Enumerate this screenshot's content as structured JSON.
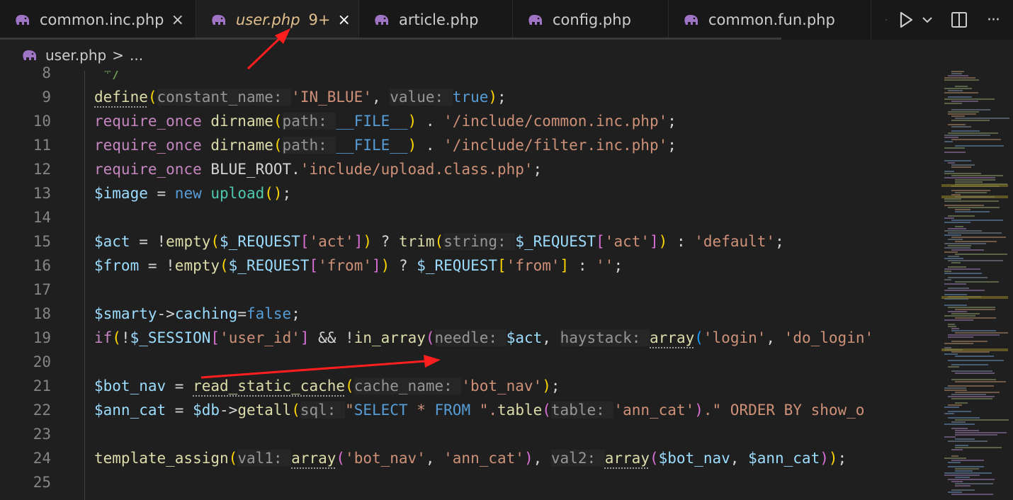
{
  "tabs": [
    {
      "label": "common.inc.php",
      "icon": "php-elephant-icon",
      "active": false,
      "close": "×"
    },
    {
      "label": "user.php",
      "icon": "php-elephant-icon",
      "active": true,
      "badge": "9+",
      "close": "×"
    },
    {
      "label": "article.php",
      "icon": "php-elephant-icon",
      "active": false
    },
    {
      "label": "config.php",
      "icon": "php-elephant-icon",
      "active": false
    },
    {
      "label": "common.fun.php",
      "icon": "php-elephant-icon",
      "active": false
    }
  ],
  "actions": {
    "run_icon": "play-icon",
    "run_dropdown_icon": "chevron-down-icon",
    "split_icon": "split-editor-icon",
    "more_icon": "more-actions-icon",
    "more_label": "···"
  },
  "breadcrumb": {
    "file": "user.php",
    "separator": ">",
    "more": "..."
  },
  "editor": {
    "line_numbers": [
      "8",
      "9",
      "10",
      "11",
      "12",
      "13",
      "14",
      "15",
      "16",
      "17",
      "18",
      "19",
      "20",
      "21",
      "22",
      "23",
      "24",
      "25"
    ]
  },
  "code_lines": [
    {
      "n": "8",
      "tokens": [
        {
          "t": " */",
          "c": "cm"
        }
      ]
    },
    {
      "n": "9",
      "tokens": [
        {
          "t": "define",
          "c": "f dl"
        },
        {
          "t": "(",
          "c": "y"
        },
        {
          "t": "constant_name: ",
          "c": "h"
        },
        {
          "t": "'IN_BLUE'",
          "c": "s"
        },
        {
          "t": ", "
        },
        {
          "t": "value: ",
          "c": "h"
        },
        {
          "t": "true",
          "c": "k"
        },
        {
          "t": ")",
          "c": "y"
        },
        {
          "t": ";"
        }
      ]
    },
    {
      "n": "10",
      "tokens": [
        {
          "t": "require_once",
          "c": "c"
        },
        {
          "t": " "
        },
        {
          "t": "dirname",
          "c": "f"
        },
        {
          "t": "(",
          "c": "y"
        },
        {
          "t": "path: ",
          "c": "h"
        },
        {
          "t": "__FILE__",
          "c": "k"
        },
        {
          "t": ")",
          "c": "y"
        },
        {
          "t": " . "
        },
        {
          "t": "'/include/common.inc.php'",
          "c": "s"
        },
        {
          "t": ";"
        }
      ]
    },
    {
      "n": "11",
      "tokens": [
        {
          "t": "require_once",
          "c": "c"
        },
        {
          "t": " "
        },
        {
          "t": "dirname",
          "c": "f"
        },
        {
          "t": "(",
          "c": "y"
        },
        {
          "t": "path: ",
          "c": "h"
        },
        {
          "t": "__FILE__",
          "c": "k"
        },
        {
          "t": ")",
          "c": "y"
        },
        {
          "t": " . "
        },
        {
          "t": "'/include/filter.inc.php'",
          "c": "s"
        },
        {
          "t": ";"
        }
      ]
    },
    {
      "n": "12",
      "tokens": [
        {
          "t": "require_once",
          "c": "c"
        },
        {
          "t": " BLUE_ROOT."
        },
        {
          "t": "'include/upload.class.php'",
          "c": "s"
        },
        {
          "t": ";"
        }
      ]
    },
    {
      "n": "13",
      "tokens": [
        {
          "t": "$image",
          "c": "v"
        },
        {
          "t": " = "
        },
        {
          "t": "new",
          "c": "k"
        },
        {
          "t": " "
        },
        {
          "t": "upload",
          "c": "t"
        },
        {
          "t": "()",
          "c": "y"
        },
        {
          "t": ";"
        }
      ]
    },
    {
      "n": "14",
      "tokens": []
    },
    {
      "n": "15",
      "tokens": [
        {
          "t": "$act",
          "c": "v"
        },
        {
          "t": " = !"
        },
        {
          "t": "empty",
          "c": "f"
        },
        {
          "t": "(",
          "c": "y"
        },
        {
          "t": "$_REQUEST",
          "c": "v"
        },
        {
          "t": "[",
          "c": "p"
        },
        {
          "t": "'act'",
          "c": "s"
        },
        {
          "t": "]",
          "c": "p"
        },
        {
          "t": ")",
          "c": "y"
        },
        {
          "t": " ? "
        },
        {
          "t": "trim",
          "c": "f"
        },
        {
          "t": "(",
          "c": "y"
        },
        {
          "t": "string: ",
          "c": "h"
        },
        {
          "t": "$_REQUEST",
          "c": "v"
        },
        {
          "t": "[",
          "c": "p"
        },
        {
          "t": "'act'",
          "c": "s"
        },
        {
          "t": "]",
          "c": "p"
        },
        {
          "t": ")",
          "c": "y"
        },
        {
          "t": " : "
        },
        {
          "t": "'default'",
          "c": "s"
        },
        {
          "t": ";"
        }
      ]
    },
    {
      "n": "16",
      "tokens": [
        {
          "t": "$from",
          "c": "v"
        },
        {
          "t": " = !"
        },
        {
          "t": "empty",
          "c": "f"
        },
        {
          "t": "(",
          "c": "y"
        },
        {
          "t": "$_REQUEST",
          "c": "v"
        },
        {
          "t": "[",
          "c": "p"
        },
        {
          "t": "'from'",
          "c": "s"
        },
        {
          "t": "]",
          "c": "p"
        },
        {
          "t": ")",
          "c": "y"
        },
        {
          "t": " ? "
        },
        {
          "t": "$_REQUEST",
          "c": "v"
        },
        {
          "t": "[",
          "c": "y"
        },
        {
          "t": "'from'",
          "c": "s"
        },
        {
          "t": "]",
          "c": "y"
        },
        {
          "t": " : "
        },
        {
          "t": "''",
          "c": "s"
        },
        {
          "t": ";"
        }
      ]
    },
    {
      "n": "17",
      "tokens": []
    },
    {
      "n": "18",
      "tokens": [
        {
          "t": "$smarty",
          "c": "v"
        },
        {
          "t": "->"
        },
        {
          "t": "caching",
          "c": "v"
        },
        {
          "t": "="
        },
        {
          "t": "false",
          "c": "k"
        },
        {
          "t": ";"
        }
      ]
    },
    {
      "n": "19",
      "tokens": [
        {
          "t": "if",
          "c": "c"
        },
        {
          "t": "(",
          "c": "y"
        },
        {
          "t": "!"
        },
        {
          "t": "$_SESSION",
          "c": "v"
        },
        {
          "t": "[",
          "c": "p"
        },
        {
          "t": "'user_id'",
          "c": "s"
        },
        {
          "t": "]",
          "c": "p"
        },
        {
          "t": " && !"
        },
        {
          "t": "in_array",
          "c": "f"
        },
        {
          "t": "(",
          "c": "p"
        },
        {
          "t": "needle: ",
          "c": "h"
        },
        {
          "t": "$act",
          "c": "v"
        },
        {
          "t": ", "
        },
        {
          "t": "haystack: ",
          "c": "h"
        },
        {
          "t": "array",
          "c": "f dl"
        },
        {
          "t": "(",
          "c": "b"
        },
        {
          "t": "'login'",
          "c": "s"
        },
        {
          "t": ", "
        },
        {
          "t": "'do_login'",
          "c": "s"
        }
      ]
    },
    {
      "n": "20",
      "tokens": []
    },
    {
      "n": "21",
      "tokens": [
        {
          "t": "$bot_nav",
          "c": "v"
        },
        {
          "t": " = "
        },
        {
          "t": "read_static_cache",
          "c": "f dl"
        },
        {
          "t": "(",
          "c": "y"
        },
        {
          "t": "cache_name: ",
          "c": "h"
        },
        {
          "t": "'bot_nav'",
          "c": "s"
        },
        {
          "t": ")",
          "c": "y"
        },
        {
          "t": ";"
        }
      ]
    },
    {
      "n": "22",
      "tokens": [
        {
          "t": "$ann_cat",
          "c": "v"
        },
        {
          "t": " = "
        },
        {
          "t": "$db",
          "c": "v"
        },
        {
          "t": "->"
        },
        {
          "t": "getall",
          "c": "f"
        },
        {
          "t": "(",
          "c": "y"
        },
        {
          "t": "sql: ",
          "c": "h"
        },
        {
          "t": "\"",
          "c": "s"
        },
        {
          "t": "SELECT",
          "c": "k"
        },
        {
          "t": " * ",
          "c": "s"
        },
        {
          "t": "FROM",
          "c": "k"
        },
        {
          "t": " \".",
          "c": "s"
        },
        {
          "t": "table",
          "c": "f"
        },
        {
          "t": "(",
          "c": "p"
        },
        {
          "t": "table: ",
          "c": "h"
        },
        {
          "t": "'ann_cat'",
          "c": "s"
        },
        {
          "t": ")",
          "c": "p"
        },
        {
          "t": ".\" ORDER BY show_o",
          "c": "s"
        }
      ]
    },
    {
      "n": "23",
      "tokens": []
    },
    {
      "n": "24",
      "tokens": [
        {
          "t": "template_assign",
          "c": "f"
        },
        {
          "t": "(",
          "c": "y"
        },
        {
          "t": "val1: ",
          "c": "h"
        },
        {
          "t": "array",
          "c": "f dl"
        },
        {
          "t": "(",
          "c": "p"
        },
        {
          "t": "'bot_nav'",
          "c": "s"
        },
        {
          "t": ", "
        },
        {
          "t": "'ann_cat'",
          "c": "s"
        },
        {
          "t": ")",
          "c": "p"
        },
        {
          "t": ", "
        },
        {
          "t": "val2: ",
          "c": "h"
        },
        {
          "t": "array",
          "c": "f dl"
        },
        {
          "t": "(",
          "c": "p"
        },
        {
          "t": "$bot_nav",
          "c": "v"
        },
        {
          "t": ", "
        },
        {
          "t": "$ann_cat",
          "c": "v"
        },
        {
          "t": ")",
          "c": "p"
        },
        {
          "t": ")",
          "c": "y"
        },
        {
          "t": ";"
        }
      ]
    },
    {
      "n": "25",
      "tokens": []
    }
  ],
  "colors": {
    "annotation_arrow": "#ff1e1e",
    "active_tab_text": "#e2c08d",
    "editor_bg": "#1f1f1f"
  }
}
